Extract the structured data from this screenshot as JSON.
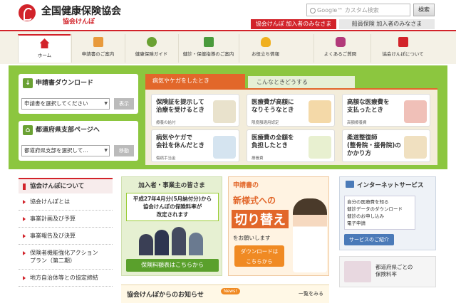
{
  "header": {
    "logo_title": "全国健康保険協会",
    "logo_sub": "協会けんぽ",
    "search_placeholder": "Google™ カスタム検索",
    "search_button": "検索",
    "aud1": "協会けんぽ 加入者のみなさま",
    "aud2": "船員保険 加入者のみなさま"
  },
  "nav": [
    {
      "label": "ホーム"
    },
    {
      "label": "申請書のご案内"
    },
    {
      "label": "健康保険ガイド"
    },
    {
      "label": "健診・保健指導のご案内"
    },
    {
      "label": "お役立ち情報"
    },
    {
      "label": "よくあるご質問"
    },
    {
      "label": "協会けんぽについて"
    }
  ],
  "download": {
    "title": "申請書ダウンロード",
    "select": "申請書を選択してください",
    "button": "表示"
  },
  "branch": {
    "title": "都道府県支部ページへ",
    "select": "都道府県支部を選択して…",
    "button": "移動"
  },
  "tabs": {
    "tab1": "病気やケガをしたとき",
    "tab2": "こんなときどうする"
  },
  "cards": [
    {
      "title": "保険証を提示して\n治療を受けるとき",
      "sub": "療養の給付"
    },
    {
      "title": "医療費が高額に\nなりそうなとき",
      "sub": "限度額適用認定"
    },
    {
      "title": "高額な医療費を\n支払ったとき",
      "sub": "高額療養費"
    },
    {
      "title": "病気やケガで\n会社を休んだとき",
      "sub": "傷病手当金"
    },
    {
      "title": "医療費の全額を\n負担したとき",
      "sub": "療養費"
    },
    {
      "title": "柔道整復師\n(整骨院・接骨院)の\nかかり方",
      "sub": ""
    }
  ],
  "side": {
    "title": "協会けんぽについて",
    "items": [
      "協会けんぽとは",
      "事業計画及び予算",
      "事業報告及び決算",
      "保険者機能強化アクション\nプラン（第二期）",
      "地方自治体等との協定締結"
    ]
  },
  "banner1": {
    "head": "加入者・事業主の皆さま",
    "notice": "平成27年4月分(5月納付分)から\n協会けんぽの保険料率が\n改定されます",
    "button": "保険料額表はこちらから"
  },
  "banner2": {
    "head": "申請書の",
    "big1": "新様式への",
    "big2": "切り替え",
    "note": "をお願いします",
    "button": "ダウンロードは\nこちらから"
  },
  "banner3": {
    "head": "インターネットサービス",
    "items": [
      "自分の医療費を知る",
      "健診データのダウンロード",
      "健診のお申し込み",
      "電子申請"
    ],
    "button": "サービスのご紹介"
  },
  "banner4": {
    "text": "都道府県ごとの\n保険料率"
  },
  "news": {
    "title": "協会けんぽからのお知らせ",
    "badge": "News!",
    "more": "一覧をみる"
  }
}
